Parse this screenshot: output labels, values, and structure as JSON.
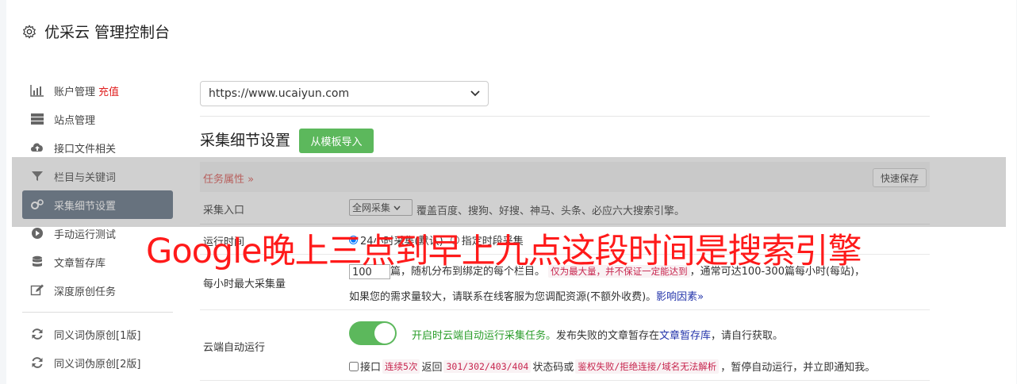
{
  "header": {
    "title": "优采云 管理控制台",
    "icon": "gear-icon"
  },
  "sidebar": {
    "items": [
      {
        "label": "账户管理",
        "badge": "充值",
        "icon": "bar-chart-icon"
      },
      {
        "label": "站点管理",
        "icon": "server-icon"
      },
      {
        "label": "接口文件相关",
        "icon": "cloud-upload-icon"
      },
      {
        "label": "栏目与关键词",
        "icon": "filter-icon"
      },
      {
        "label": "采集细节设置",
        "icon": "gears-icon",
        "active": true
      },
      {
        "label": "手动运行测试",
        "icon": "play-circle-icon"
      },
      {
        "label": "文章暂存库",
        "icon": "database-icon"
      },
      {
        "label": "深度原创任务",
        "icon": "edit-icon"
      },
      {
        "label": "同义词伪原创[1版]",
        "icon": "refresh-icon"
      },
      {
        "label": "同义词伪原创[2版]",
        "icon": "refresh-icon"
      }
    ]
  },
  "site_select": {
    "value": "https://www.ucaiyun.com"
  },
  "section": {
    "title": "采集细节设置",
    "import_button": "从模板导入"
  },
  "task_props": {
    "label": "任务属性",
    "save_button": "快速保存"
  },
  "rows": {
    "entry": {
      "label": "采集入口",
      "select_value": "全网采集",
      "desc": "覆盖百度、搜狗、好搜、神马、头条、必应六大搜索引擎。"
    },
    "time": {
      "label": "运行时间",
      "opt1": "24小时采集(默认)",
      "opt2": "指定时段采集"
    },
    "max": {
      "label": "每小时最大采集量",
      "value": "100",
      "t1": "篇，随机分布到绑定的每个栏目。",
      "code1": "仅为最大量，并不保证一定能达到",
      "t2": "，通常可达100-300篇每小时(每站)，",
      "t3": "如果您的需求量较大，请联系在线客服为您调配资源(不额外收费)。",
      "link": "影响因素"
    },
    "cloud": {
      "label": "云端自动运行",
      "green_text": "开启时云端自动运行采集任务。",
      "t1": "发布失败的文章暂存在",
      "link": "文章暂存库",
      "t2": "，请自行获取。",
      "c_label": "接口",
      "code1": "连续5次",
      "t3": "返回",
      "code2": "301/302/403/404",
      "t4": "状态码或",
      "code3": "鉴权失败/拒绝连接/域名无法解析",
      "t5": "，暂停自动运行，并立即通知我。"
    }
  },
  "overlay_caption": "Google晚上三点到早上九点这段时间是搜索引擎"
}
